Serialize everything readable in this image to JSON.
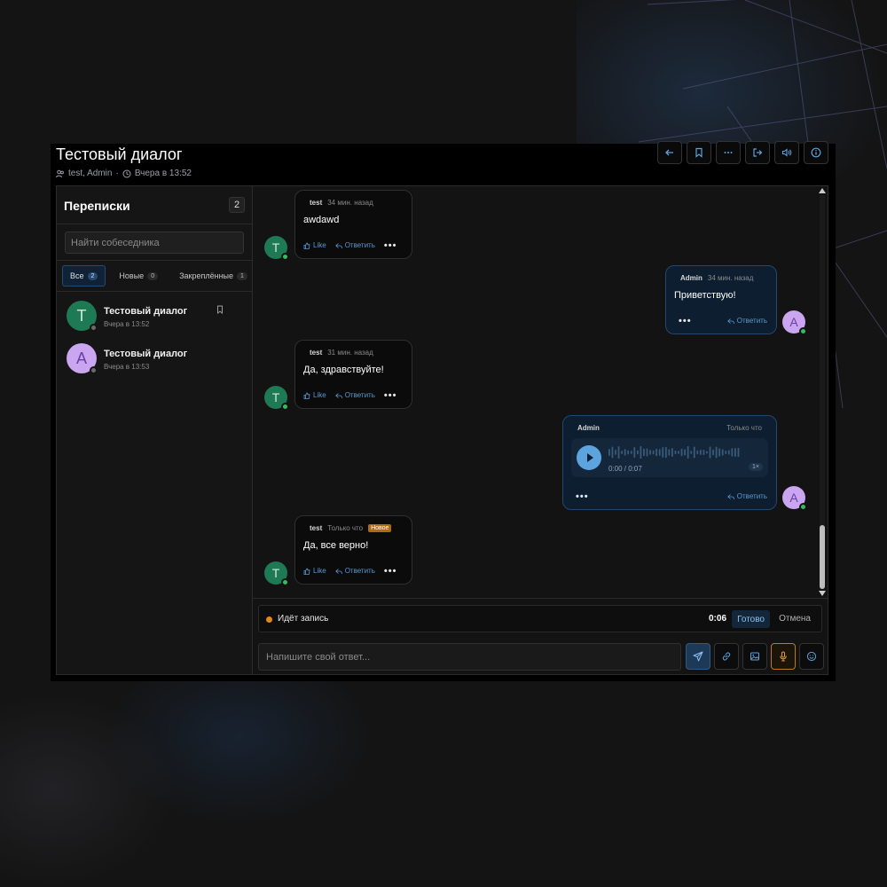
{
  "header": {
    "title": "Тестовый диалог",
    "participants": "test, Admin",
    "meta_separator": "·",
    "timestamp": "Вчера в 13:52"
  },
  "toolbar_icons": [
    "back-icon",
    "bookmark-icon",
    "more-icon",
    "forward-icon",
    "sound-icon",
    "info-icon"
  ],
  "sidebar": {
    "title": "Переписки",
    "count": "2",
    "search_placeholder": "Найти собеседника",
    "tabs": [
      {
        "label": "Все",
        "badge": "2",
        "active": true
      },
      {
        "label": "Новые",
        "badge": "0",
        "active": false
      },
      {
        "label": "Закреплённые",
        "badge": "1",
        "active": false
      }
    ],
    "conversations": [
      {
        "avatar": "T",
        "name": "Тестовый диалог",
        "time": "Вчера в 13:52",
        "avatar_color": "#1e7a55",
        "pinned_icon": "bookmark-icon"
      },
      {
        "avatar": "A",
        "name": "Тестовый диалог",
        "time": "Вчера в 13:53",
        "avatar_color": "#c9a6ef"
      }
    ]
  },
  "messages": [
    {
      "author": "test",
      "time": "34 мин. назад",
      "text": "awdawd",
      "like": "Like",
      "reply": "Ответить",
      "avatar": "T",
      "side": "in"
    },
    {
      "author": "Admin",
      "time": "34 мин. назад",
      "text": "Приветствую!",
      "reply": "Ответить",
      "avatar": "A",
      "side": "out"
    },
    {
      "author": "test",
      "time": "31 мин. назад",
      "text": "Да, здравствуйте!",
      "like": "Like",
      "reply": "Ответить",
      "avatar": "T",
      "side": "in"
    },
    {
      "author": "Admin",
      "time": "Только что",
      "voice": {
        "duration": "0:00 / 0:07",
        "speed": "1×"
      },
      "reply": "Ответить",
      "avatar": "A",
      "side": "out"
    },
    {
      "author": "test",
      "time": "Только что",
      "badge": "Новое",
      "text": "Да, все верно!",
      "like": "Like",
      "reply": "Ответить",
      "avatar": "T",
      "side": "in"
    }
  ],
  "more_label": "•••",
  "recording": {
    "label": "Идёт запись",
    "time": "0:06",
    "done": "Готово",
    "cancel": "Отмена"
  },
  "compose": {
    "placeholder": "Напишите свой ответ..."
  },
  "compose_icons": [
    "send-icon",
    "link-icon",
    "image-icon",
    "microphone-icon",
    "emoji-icon"
  ],
  "colors": {
    "accent": "#5da3de",
    "outgoing_bubble": "#0c1e30",
    "online": "#2fbf5f",
    "recording": "#e08a1e",
    "avatar_t": "#1e7a55",
    "avatar_a": "#c9a6ef"
  }
}
